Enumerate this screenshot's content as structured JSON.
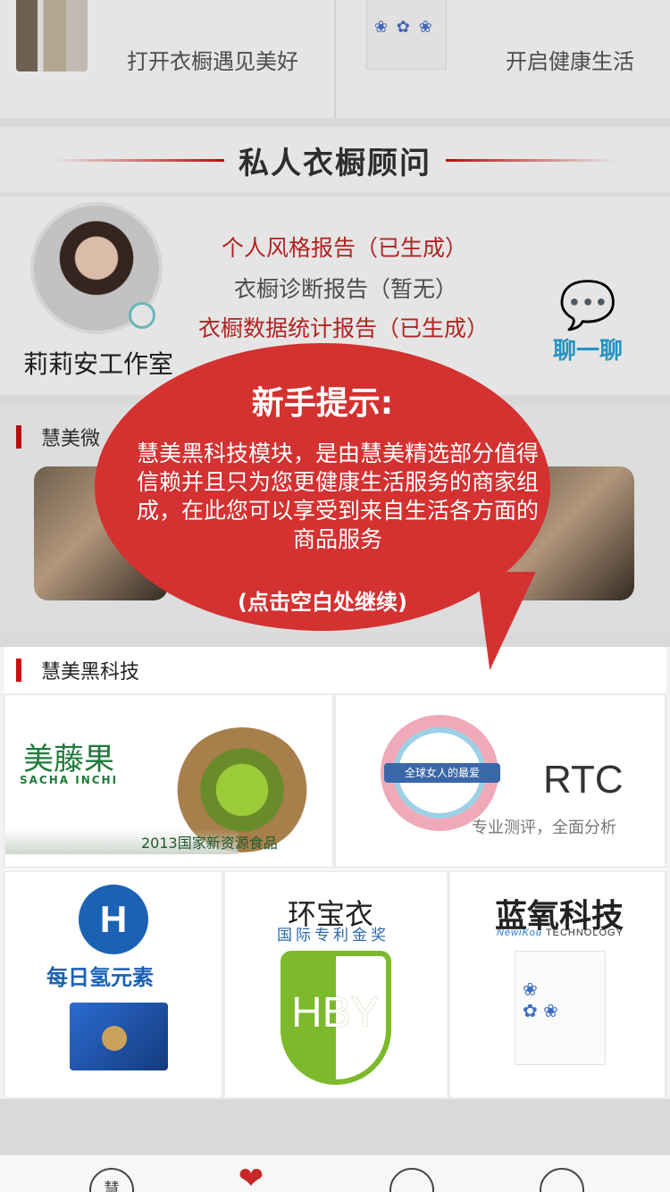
{
  "top_cards": [
    {
      "label": "打开衣橱遇见美好",
      "icon": "closet-image"
    },
    {
      "label": "开启健康生活",
      "icon": "purifier-image"
    }
  ],
  "advisor": {
    "section_title": "私人衣橱顾问",
    "name": "莉莉安工作室",
    "reports": [
      "个人风格报告（已生成）",
      "衣橱诊断报告（暂无）",
      "衣橱数据统计报告（已生成）"
    ],
    "chat_label": "聊一聊",
    "chat_icon": "chat-bubble-icon"
  },
  "weidian": {
    "title": "慧美微"
  },
  "heitech": {
    "title": "慧美黑科技",
    "tiles": {
      "sacha": {
        "logo": "美藤果",
        "subtitle": "SACHA INCHI",
        "caption": "2013国家新资源食品"
      },
      "rtc": {
        "banner": "全球女人的最爱",
        "title": "RTC",
        "subtitle": "专业测评，全面分析"
      },
      "h2": {
        "logo_letter": "H",
        "name": "每日氢元素"
      },
      "hby": {
        "top": "环宝衣",
        "sub": "国际专利金奖",
        "shield_text": "HBY"
      },
      "lanyang": {
        "title": "蓝氧科技",
        "brand": "NewiKou",
        "brand_suffix": "TECHNOLOGY"
      }
    }
  },
  "tip": {
    "title": "新手提示:",
    "body": "慧美黑科技模块，是由慧美精选部分值得信赖并且只为您更健康生活服务的商家组成，在此您可以享受到来自生活各方面的商品服务",
    "continue": "(点击空白处继续)"
  },
  "tabbar": {
    "home": "慧",
    "heart_icon": "heart-hands-icon",
    "cart_icon": "cart-icon",
    "user_icon": "user-icon"
  },
  "colors": {
    "accent_red": "#c62828",
    "bubble_red": "#d43131",
    "chat_blue": "#2aa4d8"
  }
}
